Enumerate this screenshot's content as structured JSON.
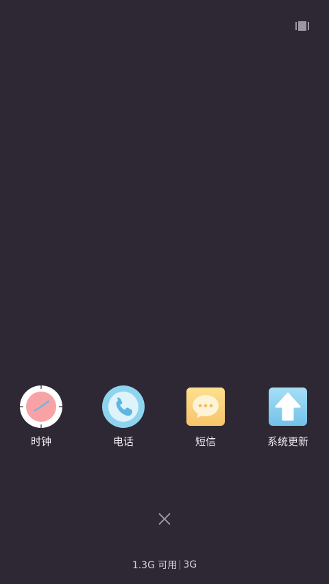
{
  "header": {
    "view_toggle_icon": "card-view-icon"
  },
  "apps": [
    {
      "label": "时钟",
      "icon": "clock-icon"
    },
    {
      "label": "电话",
      "icon": "phone-icon"
    },
    {
      "label": "短信",
      "icon": "message-icon"
    },
    {
      "label": "系统更新",
      "icon": "update-arrow-icon"
    }
  ],
  "footer": {
    "close_icon": "close-icon",
    "memory_available": "1.3G 可用",
    "memory_total": "3G"
  },
  "colors": {
    "background": "#2d2833",
    "clock_face": "#f7a3a6",
    "phone_blue": "#8ed4ef",
    "message_yellow": "#fbd685",
    "update_blue": "#8fd3f1"
  }
}
